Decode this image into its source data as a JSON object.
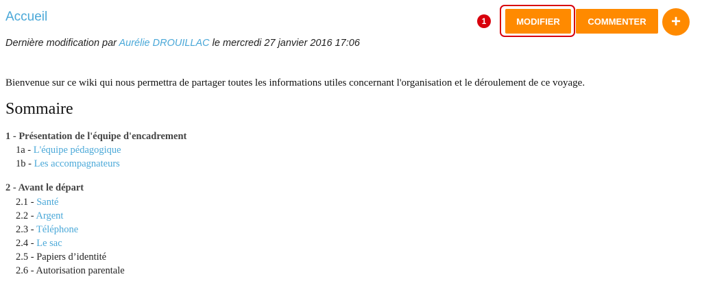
{
  "page": {
    "title": "Accueil",
    "meta": {
      "prefix": "Dernière modification par ",
      "author": "Aurélie DROUILLAC",
      "suffix": " le mercredi 27 janvier 2016 17:06"
    }
  },
  "actions": {
    "modify": "MODIFIER",
    "comment": "COMMENTER",
    "add": "+",
    "annotation_number": "1"
  },
  "content": {
    "intro": "Bienvenue sur ce wiki qui nous permettra de partager toutes les informations utiles concernant l'organisation et le déroulement de ce voyage.",
    "toc_title": "Sommaire",
    "sections": [
      {
        "title": "1 - Présentation de l'équipe d'encadrement",
        "items": [
          {
            "num": "1a - ",
            "text": "L'équipe pédagogique",
            "link": true
          },
          {
            "num": "1b - ",
            "text": "Les accompagnateurs",
            "link": true
          }
        ]
      },
      {
        "title": "2 - Avant le départ",
        "items": [
          {
            "num": "2.1 - ",
            "text": "Santé",
            "link": true
          },
          {
            "num": "2.2 - ",
            "text": "Argent",
            "link": true
          },
          {
            "num": "2.3 - ",
            "text": "Téléphone",
            "link": true
          },
          {
            "num": "2.4 - ",
            "text": "Le sac",
            "link": true
          },
          {
            "num": "2.5 - ",
            "text": "Papiers d’identité",
            "link": false
          },
          {
            "num": "2.6 - ",
            "text": "Autorisation parentale",
            "link": false
          }
        ]
      }
    ]
  },
  "colors": {
    "accent": "#ff8a00",
    "link": "#4aa8d8",
    "highlight": "#d8000c"
  }
}
